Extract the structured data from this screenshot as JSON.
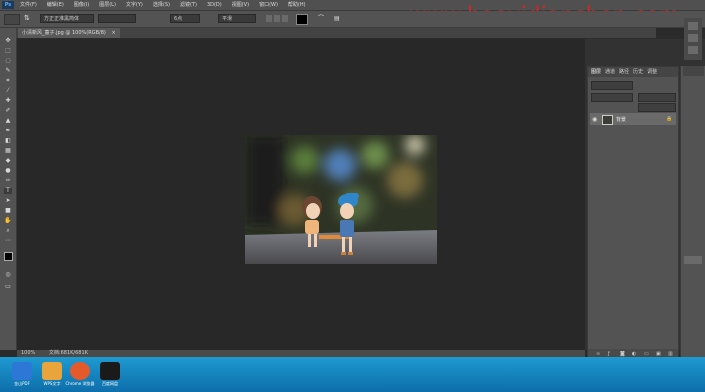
{
  "app": {
    "logo": "Ps"
  },
  "menu": [
    "文件(F)",
    "编辑(E)",
    "图像(I)",
    "图层(L)",
    "文字(Y)",
    "选择(S)",
    "滤镜(T)",
    "3D(D)",
    "视图(V)",
    "窗口(W)",
    "帮助(H)"
  ],
  "watermark": "www.haoyidianshop.com",
  "options": {
    "font_family": "方正正准黑简体",
    "font_size": "6点",
    "aa": "平滑"
  },
  "document_tab": {
    "title": "小清新风_童子.jpg @ 100%(RGB/8)",
    "close": "×"
  },
  "layers_panel": {
    "tabs": [
      "图层",
      "通道",
      "路径",
      "历史",
      "调整"
    ],
    "layer_name": "背景"
  },
  "status": {
    "zoom": "100%",
    "doc": "文档:681K/681K"
  },
  "taskbar": {
    "items": [
      {
        "label": "金山PDF",
        "color": "#2d78d6"
      },
      {
        "label": "WPS文字",
        "color": "#e9a43b"
      },
      {
        "label": "Chrome 浏览器",
        "color": "#e55a2b"
      },
      {
        "label": "百度网盘",
        "color": "#1a1a1a"
      }
    ]
  }
}
